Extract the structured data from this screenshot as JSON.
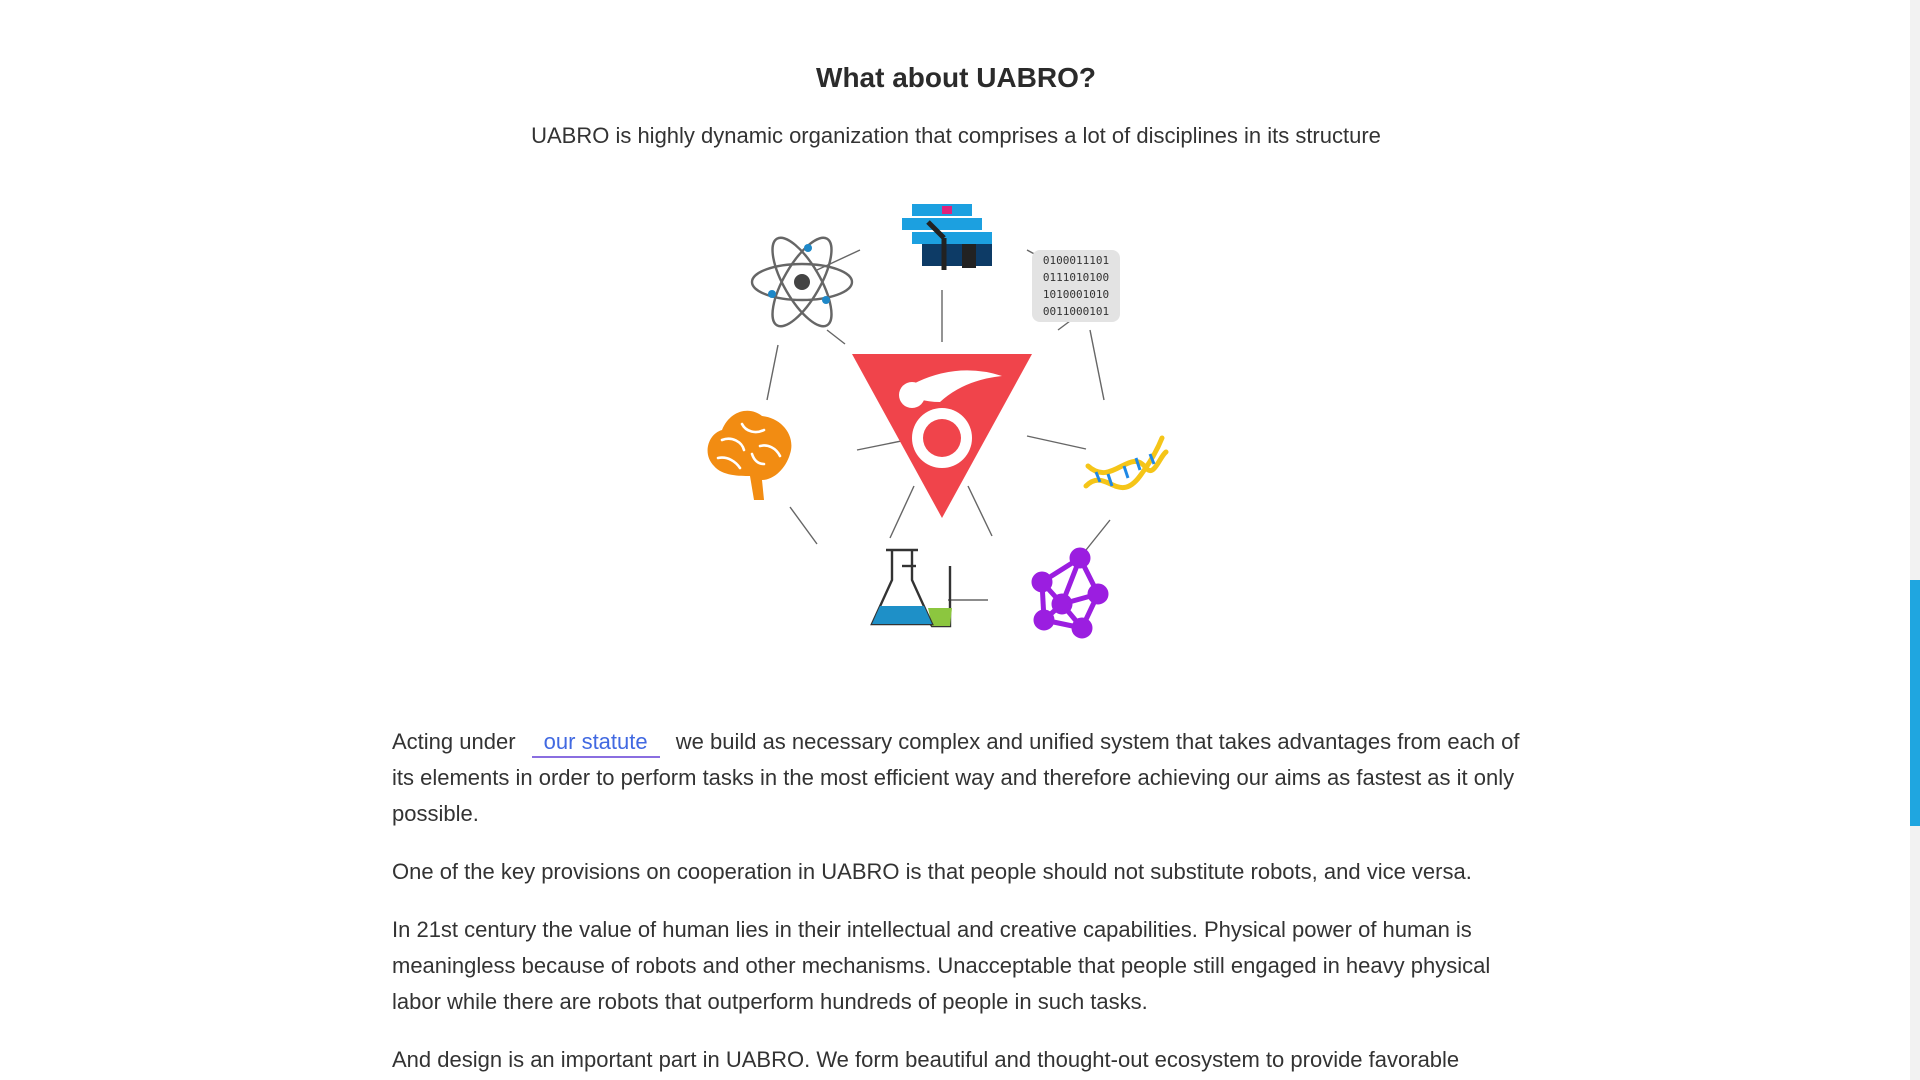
{
  "section": {
    "title": "What about UABRO?",
    "subtitle": "UABRO is highly dynamic organization that comprises a lot of disciplines in its structure"
  },
  "diagram": {
    "binary_lines": [
      "0100011101",
      "0111010100",
      "1010001010",
      "0011000101"
    ],
    "icons": [
      "uabro-logo-icon",
      "atom-icon",
      "factory-icon",
      "binary-code-icon",
      "dna-icon",
      "network-icon",
      "flasks-icon",
      "brain-icon"
    ],
    "colors": {
      "logo_red": "#f0444b",
      "brain_orange": "#f28c12",
      "network_purple": "#9b1ee0",
      "dna_yellow": "#f5c518",
      "dna_blue": "#1e88e5",
      "flask_blue": "#1e90c8",
      "flask_green": "#8cc63f",
      "factory_blue": "#1ca0e0",
      "factory_pink": "#e0227a"
    }
  },
  "paragraphs": {
    "p1_before": "Acting under",
    "p1_link": "our statute",
    "p1_after": "we build as necessary complex and unified system that takes advantages from each of its elements in order to perform tasks in the most efficient way and therefore achieving our aims as fastest as it only possible.",
    "p2": "One of the key provisions on cooperation in UABRO is that people should not substitute robots, and vice versa.",
    "p3": "In 21st century the value of human lies in their intellectual and creative capabilities. Physical power of human is meaningless because of robots and other mechanisms. Unacceptable that people still engaged in heavy physical labor while there are robots that outperform hundreds of people in such tasks.",
    "p4": "And design is an important part in UABRO. We form beautiful and thought-out ecosystem to provide favorable"
  },
  "scrollbar": {
    "accent": "#1fa6e0"
  }
}
